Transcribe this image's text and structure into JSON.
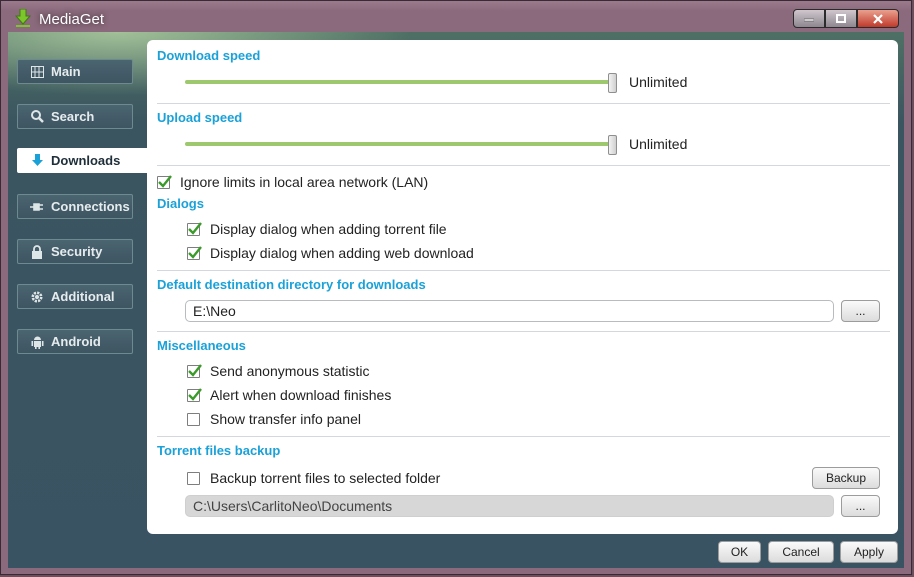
{
  "window": {
    "title": "MediaGet"
  },
  "sidebar": {
    "items": [
      {
        "label": "Main",
        "icon": "grid-icon"
      },
      {
        "label": "Search",
        "icon": "search-icon"
      },
      {
        "label": "Downloads",
        "icon": "download-arrow-icon",
        "active": true
      },
      {
        "label": "Connections",
        "icon": "plug-icon"
      },
      {
        "label": "Security",
        "icon": "lock-icon"
      },
      {
        "label": "Additional",
        "icon": "gear-icon"
      },
      {
        "label": "Android",
        "icon": "android-icon"
      }
    ]
  },
  "settings": {
    "download_speed": {
      "title": "Download speed",
      "value": "Unlimited"
    },
    "upload_speed": {
      "title": "Upload speed",
      "value": "Unlimited"
    },
    "ignore_lan": {
      "label": "Ignore limits in local area network (LAN)",
      "checked": true
    },
    "dialogs": {
      "title": "Dialogs",
      "torrent_file": {
        "label": "Display dialog when adding torrent file",
        "checked": true
      },
      "web_download": {
        "label": "Display dialog when adding web download",
        "checked": true
      }
    },
    "destination": {
      "title": "Default destination directory for downloads",
      "path": "E:\\Neo",
      "browse_label": "..."
    },
    "misc": {
      "title": "Miscellaneous",
      "anonymous_statistic": {
        "label": "Send anonymous statistic",
        "checked": true
      },
      "alert_finish": {
        "label": "Alert when download finishes",
        "checked": true
      },
      "transfer_panel": {
        "label": "Show transfer info panel",
        "checked": false
      }
    },
    "backup": {
      "title": "Torrent files backup",
      "backup_checkbox": {
        "label": "Backup torrent files to selected folder",
        "checked": false
      },
      "backup_button": "Backup",
      "path": "C:\\Users\\CarlitoNeo\\Documents",
      "browse_label": "..."
    }
  },
  "footer": {
    "ok": "OK",
    "cancel": "Cancel",
    "apply": "Apply"
  },
  "colors": {
    "accent": "#1aa1d8",
    "slider": "#9dc86e",
    "check": "#3a9a2a"
  }
}
